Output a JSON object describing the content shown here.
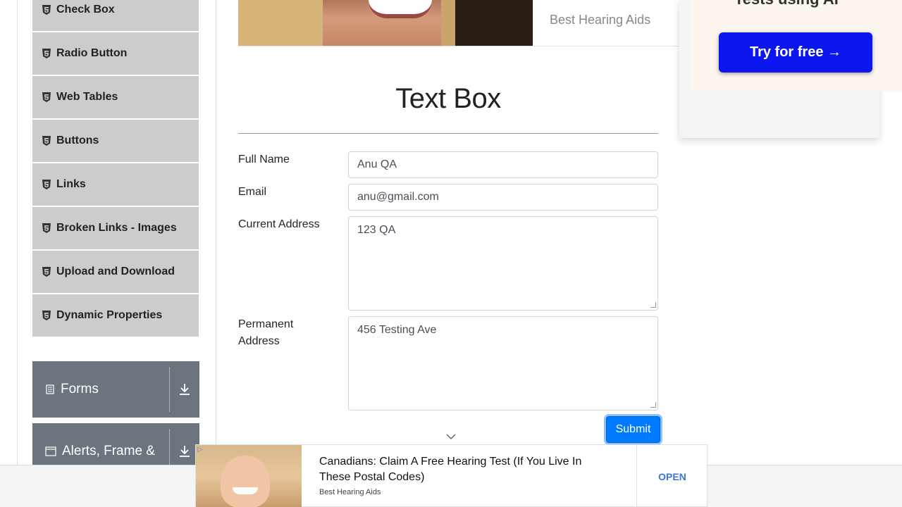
{
  "sidebar": {
    "items": [
      {
        "label": "Check Box",
        "icon": "html5-icon"
      },
      {
        "label": "Radio Button",
        "icon": "html5-icon"
      },
      {
        "label": "Web Tables",
        "icon": "html5-icon"
      },
      {
        "label": "Buttons",
        "icon": "html5-icon"
      },
      {
        "label": "Links",
        "icon": "html5-icon"
      },
      {
        "label": "Broken Links - Images",
        "icon": "html5-icon"
      },
      {
        "label": "Upload and Download",
        "icon": "html5-icon"
      },
      {
        "label": "Dynamic Properties",
        "icon": "html5-icon"
      }
    ],
    "groups": [
      {
        "label": "Forms",
        "icon": "document-icon"
      },
      {
        "label": "Alerts, Frame &",
        "icon": "window-icon"
      }
    ]
  },
  "top_ad": {
    "brand": "Best Hearing Aids"
  },
  "right_ad": {
    "headline": "Tests using AI",
    "cta": "Try for free →",
    "cta_color": "#0b16f0"
  },
  "form": {
    "title": "Text Box",
    "fields": {
      "full_name": {
        "label": "Full Name",
        "value": "Anu QA"
      },
      "email": {
        "label": "Email",
        "value": "anu@gmail.com"
      },
      "current_address": {
        "label": "Current Address",
        "value": "123 QA"
      },
      "permanent_address": {
        "label": "Permanent Address",
        "value": "456 Testing Ave"
      }
    },
    "submit_label": "Submit",
    "submit_color": "#007bff"
  },
  "bottom_ad": {
    "headline": "Canadians: Claim A Free Hearing Test (If You Live In These Postal Codes)",
    "source": "Best Hearing Aids",
    "open_label": "OPEN",
    "adchoice": "▷"
  }
}
